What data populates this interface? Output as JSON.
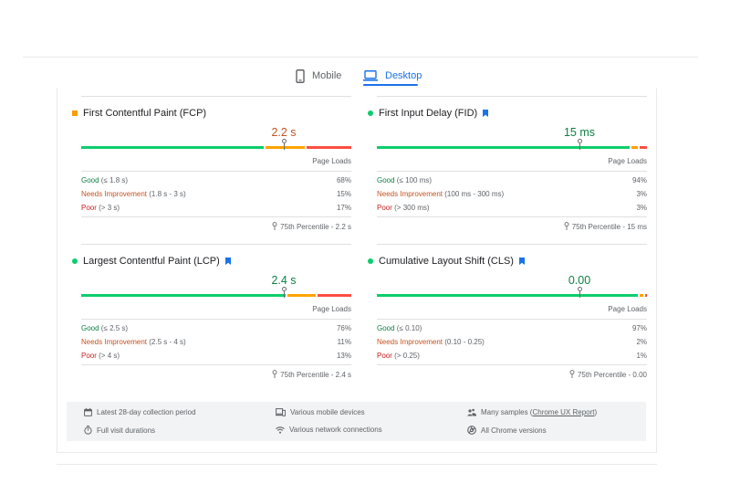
{
  "tabs": {
    "mobile_label": "Mobile",
    "desktop_label": "Desktop",
    "selected": "Desktop",
    "accent_color": "#1a73e8"
  },
  "metrics": {
    "fcp": {
      "title": "First Contentful Paint (FCP)",
      "indicator": "orange-square",
      "value": "2.2 s",
      "marker_position": 0.75,
      "distribution": [
        0.68,
        0.15,
        0.17
      ],
      "page_loads_label": "Page Loads",
      "rows": [
        {
          "label": "Good",
          "threshold": " (≤ 1.8 s)",
          "pct": "68%"
        },
        {
          "label": "Needs Improvement",
          "threshold": " (1.8 s - 3 s)",
          "pct": "15%"
        },
        {
          "label": "Poor",
          "threshold": " (> 3 s)",
          "pct": "17%"
        }
      ],
      "percentile": "75th Percentile - 2.2 s"
    },
    "fid": {
      "title": "First Input Delay (FID)",
      "indicator": "green-dot",
      "bookmark_icon": "bookmark-icon",
      "value": "15 ms",
      "marker_position": 0.75,
      "distribution": [
        0.94,
        0.03,
        0.03
      ],
      "page_loads_label": "Page Loads",
      "rows": [
        {
          "label": "Good",
          "threshold": " (≤ 100 ms)",
          "pct": "94%"
        },
        {
          "label": "Needs Improvement",
          "threshold": " (100 ms - 300 ms)",
          "pct": "3%"
        },
        {
          "label": "Poor",
          "threshold": " (> 300 ms)",
          "pct": "3%"
        }
      ],
      "percentile": "75th Percentile - 15 ms"
    },
    "lcp": {
      "title": "Largest Contentful Paint (LCP)",
      "indicator": "green-dot",
      "bookmark_icon": "bookmark-icon",
      "value": "2.4 s",
      "marker_position": 0.75,
      "distribution": [
        0.76,
        0.11,
        0.13
      ],
      "page_loads_label": "Page Loads",
      "rows": [
        {
          "label": "Good",
          "threshold": " (≤ 2.5 s)",
          "pct": "76%"
        },
        {
          "label": "Needs Improvement",
          "threshold": " (2.5 s - 4 s)",
          "pct": "11%"
        },
        {
          "label": "Poor",
          "threshold": " (> 4 s)",
          "pct": "13%"
        }
      ],
      "percentile": "75th Percentile - 2.4 s"
    },
    "cls": {
      "title": "Cumulative Layout Shift (CLS)",
      "indicator": "green-dot",
      "bookmark_icon": "bookmark-icon",
      "value": "0.00",
      "marker_position": 0.75,
      "distribution": [
        0.97,
        0.02,
        0.01
      ],
      "page_loads_label": "Page Loads",
      "rows": [
        {
          "label": "Good",
          "threshold": " (≤ 0.10)",
          "pct": "97%"
        },
        {
          "label": "Needs Improvement",
          "threshold": " (0.10 - 0.25)",
          "pct": "2%"
        },
        {
          "label": "Poor",
          "threshold": " (> 0.25)",
          "pct": "1%"
        }
      ],
      "percentile": "75th Percentile - 0.00"
    }
  },
  "footer": {
    "collection_period": "Latest 28-day collection period",
    "visit_durations": "Full visit durations",
    "mobile_devices": "Various mobile devices",
    "network_connections": "Various network connections",
    "samples_prefix": "Many samples (",
    "samples_link": "Chrome UX Report",
    "samples_suffix": ")",
    "chrome_versions": "All Chrome versions"
  },
  "colors": {
    "good": "#0cce6b",
    "needs_improvement": "#ffa400",
    "poor": "#ff4e42",
    "good_text": "#0d8043",
    "ni_text": "#c5521f",
    "poor_text": "#c5221f",
    "bookmark": "#1a73e8"
  }
}
